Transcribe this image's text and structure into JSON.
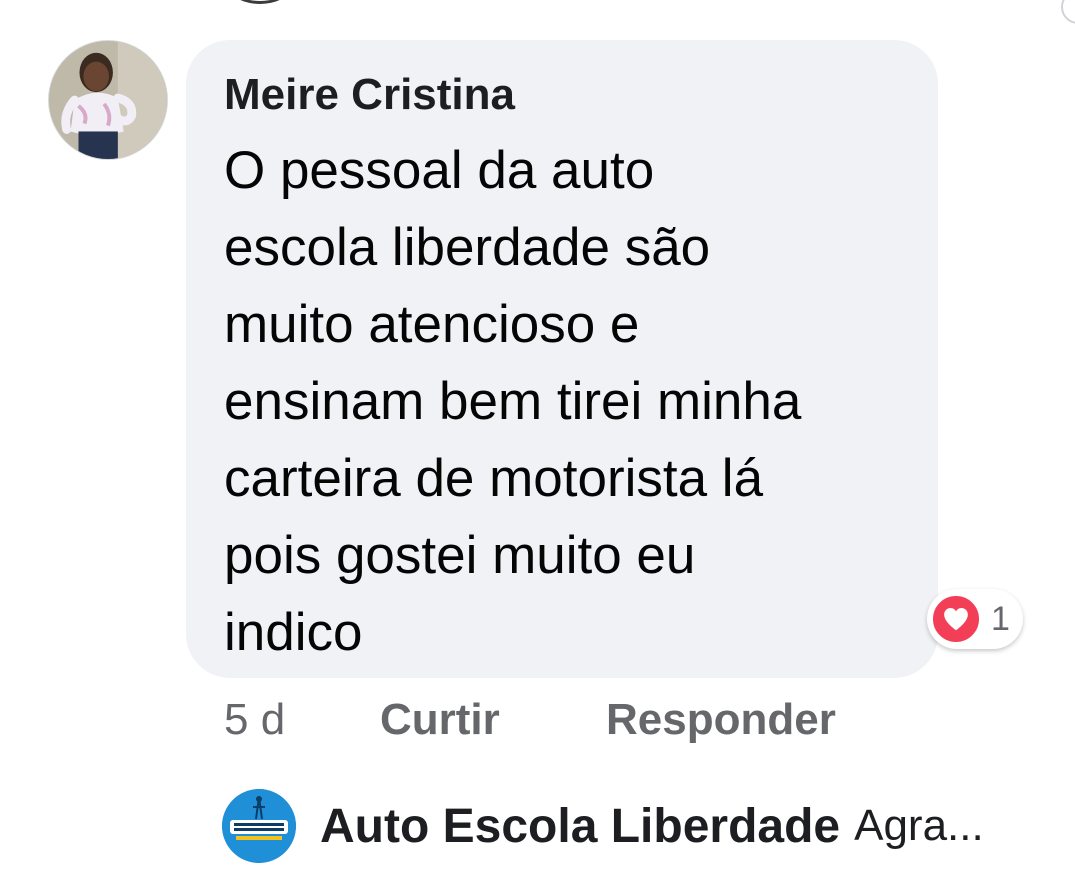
{
  "comment": {
    "author": "Meire Cristina",
    "text_lines": [
      "O pessoal da auto",
      "escola liberdade são",
      "muito atencioso e",
      "ensinam bem tirei minha",
      "carteira de motorista lá",
      "pois gostei muito eu",
      "indico"
    ],
    "time": "5 d",
    "like_label": "Curtir",
    "reply_label": "Responder",
    "reaction": {
      "icon": "heart-icon",
      "count": "1",
      "color": "#f33e58"
    }
  },
  "reply": {
    "author": "Auto Escola Liberdade",
    "preview": "Agra...",
    "avatar_icon": "auto-escola-liberdade-logo",
    "avatar_color": "#1f8fd8"
  }
}
